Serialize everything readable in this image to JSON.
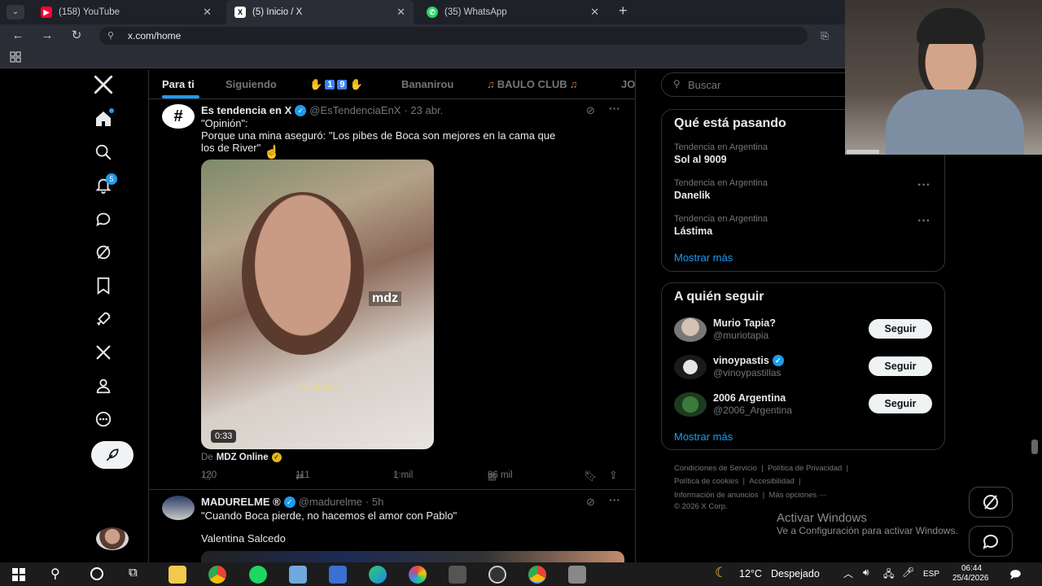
{
  "browser": {
    "tabs": [
      {
        "label": "(158) YouTube",
        "color": "#ff0033"
      },
      {
        "label": "(5) Inicio / X",
        "color": "#000000"
      },
      {
        "label": "(35) WhatsApp",
        "color": "#25d366"
      }
    ],
    "url": "x.com/home",
    "new_tab": "+"
  },
  "feed_tabs": [
    "Para ti",
    "Siguiendo",
    "1",
    "9",
    "Bananirou",
    "BAULO CLUB",
    "JO"
  ],
  "tweets": [
    {
      "name": "Es tendencia en X",
      "handle": "@EsTendenciaEnX",
      "time": "· 23 abr.",
      "avatar_text": "#",
      "text_line1": "\"Opinión\":",
      "text_line2": "Porque una mina aseguró: \"Los pibes de Boca son mejores en la cama que",
      "text_line3": "los de River\"",
      "video_duration": "0:33",
      "video_watermark": "mdz",
      "video_caption": "DE BOCA Y",
      "source_prefix": "De",
      "source_name": "MDZ Online",
      "replies": "120",
      "retweets": "111",
      "likes": "1 mil",
      "views": "86 mil"
    },
    {
      "name": "MADURELME ®",
      "handle": "@madurelme",
      "time": "· 5h",
      "text_line1": "\"Cuando Boca pierde, no hacemos el amor con Pablo\"",
      "text_line2": "Valentina Salcedo"
    }
  ],
  "search": {
    "placeholder": "Buscar"
  },
  "trends": {
    "title": "Qué está pasando",
    "items": [
      {
        "category": "Tendencia en Argentina",
        "name": "Sol al 9009"
      },
      {
        "category": "Tendencia en Argentina",
        "name": "Danelik"
      },
      {
        "category": "Tendencia en Argentina",
        "name": "Lástima"
      }
    ],
    "show_more": "Mostrar más"
  },
  "who_to_follow": {
    "title": "A quién seguir",
    "items": [
      {
        "name": "Murio Tapia?",
        "handle": "@muriotapia",
        "button": "Seguir"
      },
      {
        "name": "vinoypastis",
        "handle": "@vinoypastillas",
        "button": "Seguir"
      },
      {
        "name": "2006 Argentina",
        "handle": "@2006_Argentina",
        "button": "Seguir"
      }
    ],
    "show_more": "Mostrar más"
  },
  "footer": {
    "line1a": "Condiciones de Servicio",
    "line1b": "Política de Privacidad",
    "line2a": "Política de cookies",
    "line2b": "Accesibilidad",
    "line3a": "Información de anuncios",
    "line3b": "Más opciones ···",
    "copyright": "© 2026 X Corp."
  },
  "watermark": {
    "line1": "Activar Windows",
    "line2": "Ve a Configuración para activar Windows."
  },
  "notification_badge": "5",
  "taskbar": {
    "weather_temp": "12°C",
    "weather_text": "Despejado",
    "lang": "ESP",
    "time": "06:44",
    "date": "25/4/2026"
  },
  "icons": [
    "x-logo-icon",
    "home-icon",
    "search-icon",
    "bell-icon",
    "messages-icon",
    "grok-icon",
    "bookmark-icon",
    "rocket-icon",
    "x-premium-icon",
    "profile-icon",
    "more-icon",
    "post-icon"
  ],
  "colors": {
    "accent": "#1d9bf0",
    "bg": "#000000",
    "text": "#e7e9ea",
    "muted": "#71767b"
  }
}
